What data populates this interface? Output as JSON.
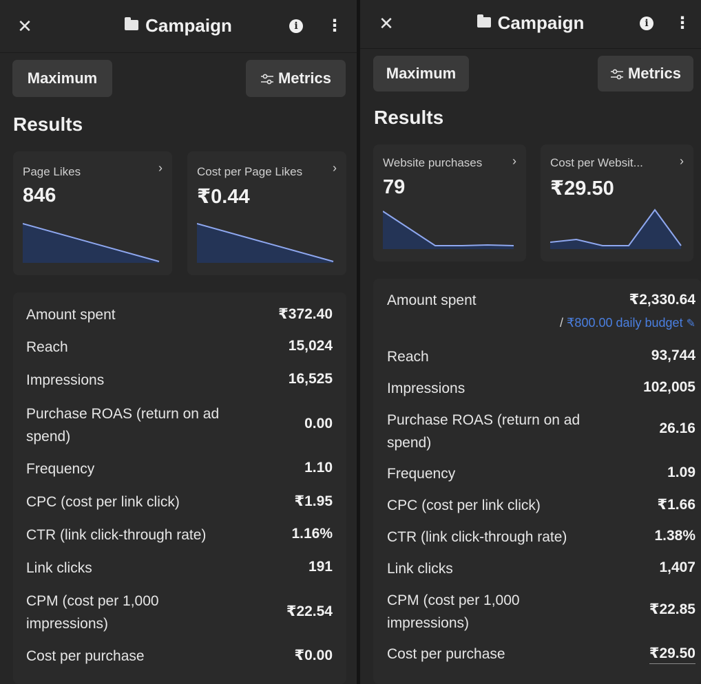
{
  "left": {
    "header": {
      "title": "Campaign"
    },
    "toolbar": {
      "maximum_label": "Maximum",
      "metrics_label": "Metrics"
    },
    "results_heading": "Results",
    "cards": [
      {
        "label": "Page Likes",
        "value": "846"
      },
      {
        "label": "Cost per Page Likes",
        "value": "₹0.44"
      }
    ],
    "metrics": [
      {
        "label": "Amount spent",
        "value": "₹372.40"
      },
      {
        "label": "Reach",
        "value": "15,024"
      },
      {
        "label": "Impressions",
        "value": "16,525"
      },
      {
        "label": "Purchase ROAS (return on ad spend)",
        "value": "0.00"
      },
      {
        "label": "Frequency",
        "value": "1.10"
      },
      {
        "label": "CPC (cost per link click)",
        "value": "₹1.95"
      },
      {
        "label": "CTR (link click-through rate)",
        "value": "1.16%"
      },
      {
        "label": "Link clicks",
        "value": "191"
      },
      {
        "label": "CPM (cost per 1,000 impressions)",
        "value": "₹22.54"
      },
      {
        "label": "Cost per purchase",
        "value": "₹0.00"
      }
    ]
  },
  "right": {
    "header": {
      "title": "Campaign"
    },
    "toolbar": {
      "maximum_label": "Maximum",
      "metrics_label": "Metrics"
    },
    "results_heading": "Results",
    "cards": [
      {
        "label": "Website purchases",
        "value": "79"
      },
      {
        "label": "Cost per Websit...",
        "value": "₹29.50"
      }
    ],
    "budget": {
      "prefix": "/",
      "link": "₹800.00 daily budget"
    },
    "metrics": [
      {
        "label": "Amount spent",
        "value": "₹2,330.64"
      },
      {
        "label": "Reach",
        "value": "93,744"
      },
      {
        "label": "Impressions",
        "value": "102,005"
      },
      {
        "label": "Purchase ROAS (return on ad spend)",
        "value": "26.16"
      },
      {
        "label": "Frequency",
        "value": "1.09"
      },
      {
        "label": "CPC (cost per link click)",
        "value": "₹1.66"
      },
      {
        "label": "CTR (link click-through rate)",
        "value": "1.38%"
      },
      {
        "label": "Link clicks",
        "value": "1,407"
      },
      {
        "label": "CPM (cost per 1,000 impressions)",
        "value": "₹22.85"
      },
      {
        "label": "Cost per purchase",
        "value": "₹29.50"
      }
    ]
  },
  "theme": {
    "background": "#262626",
    "card": "#2c2c2c",
    "button": "#3a3a3a",
    "sparkline_stroke": "#8fa8f0",
    "sparkline_fill": "#243456",
    "link": "#4a7fe0"
  },
  "icons": [
    "close-icon",
    "folder-icon",
    "info-icon",
    "more-vertical-icon",
    "sliders-icon",
    "chevron-right-icon",
    "pencil-icon"
  ]
}
